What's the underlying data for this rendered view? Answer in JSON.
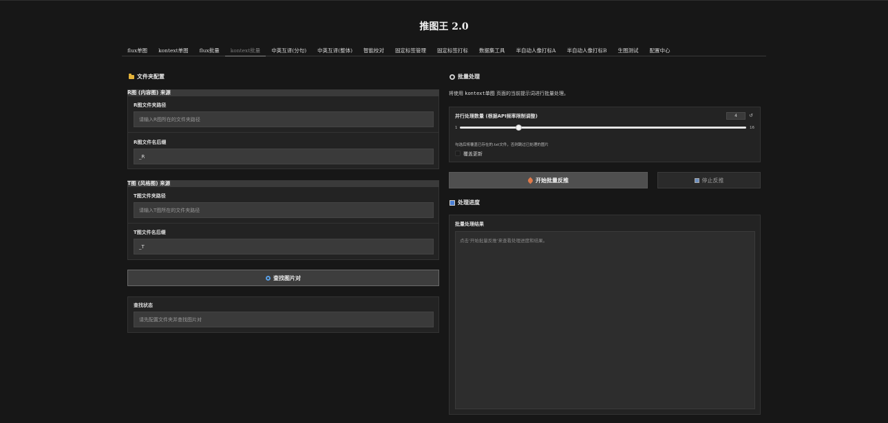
{
  "app": {
    "title": "推图王 2.0"
  },
  "tabs": [
    {
      "label": "flux单图"
    },
    {
      "label": "kontext单图"
    },
    {
      "label": "flux批量"
    },
    {
      "label": "kontext批量",
      "active": true
    },
    {
      "label": "中英互译(分句)"
    },
    {
      "label": "中英互译(整体)"
    },
    {
      "label": "智能校对"
    },
    {
      "label": "固定标签管理"
    },
    {
      "label": "固定标签打标"
    },
    {
      "label": "数据集工具"
    },
    {
      "label": "半自动人像打标A"
    },
    {
      "label": "半自动人像打标B"
    },
    {
      "label": "生图测试"
    },
    {
      "label": "配置中心"
    }
  ],
  "left": {
    "section_title": "文件夹配置",
    "r_group": {
      "title": "R图 (内容图) 来源",
      "path_label": "R图文件夹路径",
      "path_placeholder": "请输入R图所在的文件夹路径",
      "suffix_label": "R图文件名后缀",
      "suffix_value": "_R"
    },
    "t_group": {
      "title": "T图 (风格图) 来源",
      "path_label": "T图文件夹路径",
      "path_placeholder": "请输入T图所在的文件夹路径",
      "suffix_label": "T图文件名后缀",
      "suffix_value": "_T"
    },
    "find_button": "查找图片对",
    "status": {
      "label": "查找状态",
      "placeholder": "请先配置文件夹并查找图片对"
    }
  },
  "right": {
    "section_title": "批量处理",
    "desc_prefix": "将使用",
    "desc_code": "kontext单图",
    "desc_suffix": "页面的当前提示词进行批量处理。",
    "concurrency": {
      "label": "并行处理数量 (根据API频率限制调整)",
      "value": "4",
      "min": "1",
      "max": "16",
      "reset_glyph": "↺"
    },
    "overwrite": {
      "hint": "勾选后将覆盖已存在的.txt文件，否则跳过已处理的图片",
      "label": "覆盖更新",
      "checked": false
    },
    "start_button": "开始批量反推",
    "stop_button": "停止反推",
    "progress_title": "处理进度",
    "result": {
      "label": "批量处理结果",
      "placeholder": "点击'开始批量反推'来查看处理进度和结果。"
    }
  },
  "colors": {
    "background": "#171717",
    "panel": "#232323",
    "input": "#3a3a3a",
    "accent_folder": "#e4b33a"
  }
}
